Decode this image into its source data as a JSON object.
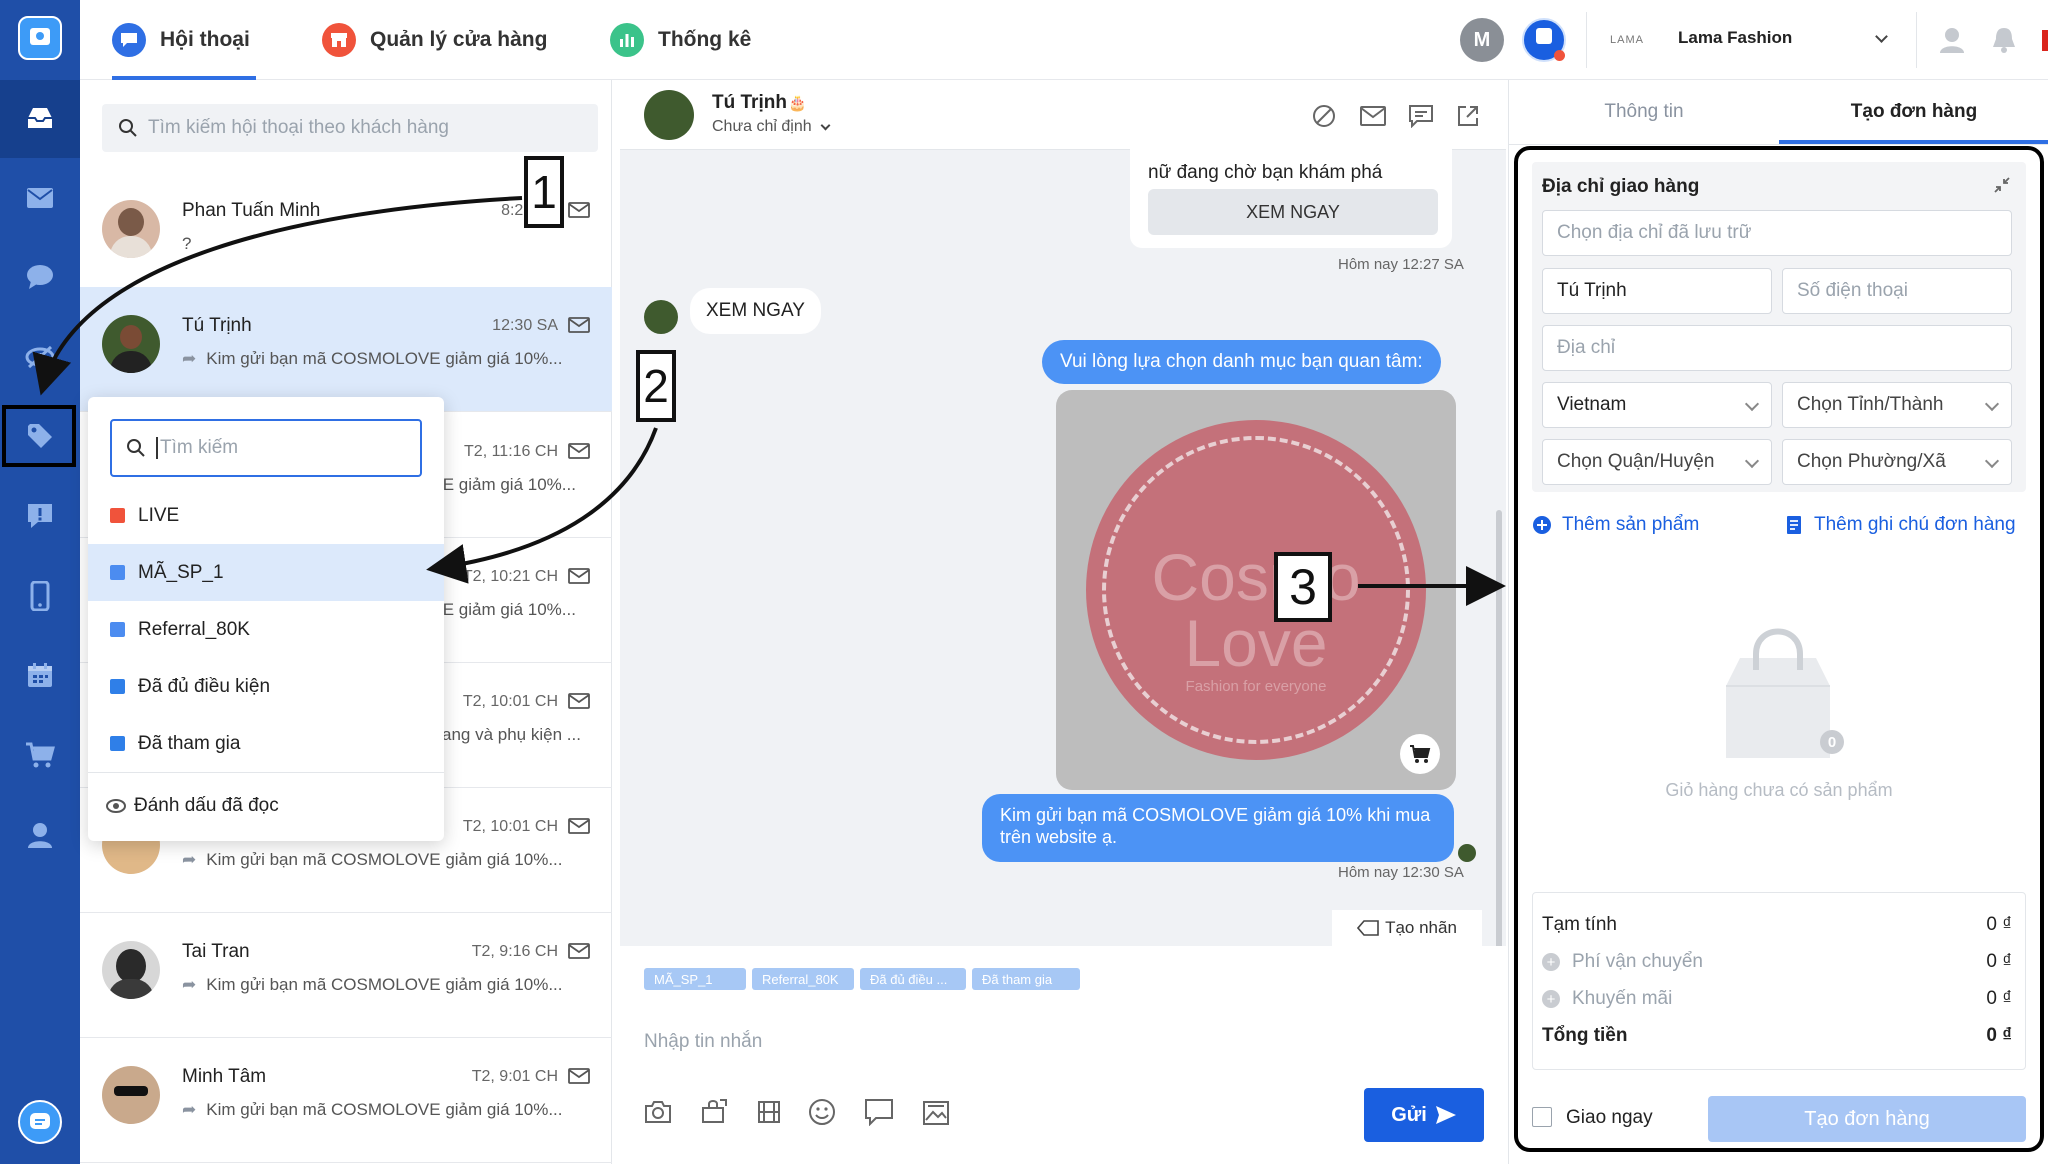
{
  "topbar": {
    "tabs": [
      {
        "label": "Hội thoại",
        "color": "#2f6fe4"
      },
      {
        "label": "Quản lý cửa hàng",
        "color": "#f0533b"
      },
      {
        "label": "Thống kê",
        "color": "#3bc38a"
      }
    ],
    "avatar_letter": "M",
    "shop_logo_text": "LAMA",
    "shop_name": "Lama Fashion"
  },
  "sidebar": {
    "icons": [
      "chat-logo-icon",
      "inbox-icon",
      "mail-icon",
      "comment-icon",
      "eye-off-icon",
      "tag-icon",
      "alert-icon",
      "phone-icon",
      "calendar-icon",
      "cart-icon",
      "user-icon",
      "messenger-icon"
    ]
  },
  "conversations": {
    "search_placeholder": "Tìm kiếm hội thoại theo khách hàng",
    "items": [
      {
        "name": "Phan Tuấn Minh",
        "time": "8:25 SA",
        "preview": "?",
        "reply": false
      },
      {
        "name": "Tú Trịnh",
        "time": "12:30 SA",
        "preview": "Kim gửi bạn mã COSMOLOVE giảm giá 10%...",
        "reply": true
      },
      {
        "name": "",
        "time": "T2, 11:16 CH",
        "preview": "/E giảm giá 10%...",
        "reply": false
      },
      {
        "name": "",
        "time": "T2, 10:21 CH",
        "preview": "/E giảm giá 10%...",
        "reply": false
      },
      {
        "name": "",
        "time": "T2, 10:01 CH",
        "preview": "ang và phụ kiện ...",
        "reply": false
      },
      {
        "name": "",
        "time": "T2, 10:01 CH",
        "preview": "Kim gửi bạn mã COSMOLOVE giảm giá 10%...",
        "reply": true
      },
      {
        "name": "Tai Tran",
        "time": "T2, 9:16 CH",
        "preview": "Kim gửi bạn mã COSMOLOVE giảm giá 10%...",
        "reply": true
      },
      {
        "name": "Minh Tâm",
        "time": "T2, 9:01 CH",
        "preview": "Kim gửi bạn mã COSMOLOVE giảm giá 10%...",
        "reply": true
      }
    ]
  },
  "tag_dropdown": {
    "search_placeholder": "Tìm kiếm",
    "tags": [
      {
        "label": "LIVE",
        "color": "#f0533b"
      },
      {
        "label": "MÃ_SP_1",
        "color": "#4c8cf0"
      },
      {
        "label": "Referral_80K",
        "color": "#4c8cf0"
      },
      {
        "label": "Đã đủ điều kiện",
        "color": "#2f7fe8"
      },
      {
        "label": "Đã tham gia",
        "color": "#2f7fe8"
      }
    ],
    "mark_read": "Đánh dấu đã đọc"
  },
  "chat": {
    "contact_name": "Tú Trịnh",
    "assign_status": "Chưa chỉ định",
    "card_text": "nữ đang chờ bạn khám phá",
    "card_button": "XEM NGAY",
    "time1": "Hôm nay 12:27 SA",
    "incoming": "XEM NGAY",
    "outgoing1": "Vui lòng lựa chọn danh mục bạn quan tâm:",
    "image_brand": "Cosmo Love",
    "image_tagline": "Fashion for everyone",
    "outgoing2": "Kim gửi bạn mã COSMOLOVE giảm giá 10% khi mua trên website ạ.",
    "time2": "Hôm nay 12:30 SA",
    "create_label": "Tạo nhãn",
    "tags": [
      "MÃ_SP_1",
      "Referral_80K",
      "Đã đủ điều ...",
      "Đã tham gia"
    ],
    "input_placeholder": "Nhập tin nhắn",
    "send": "Gửi"
  },
  "order": {
    "tabs": [
      "Thông tin",
      "Tạo đơn hàng"
    ],
    "section_title": "Địa chỉ giao hàng",
    "saved_address": "Chọn địa chỉ đã lưu trữ",
    "name_value": "Tú Trịnh",
    "phone_placeholder": "Số điện thoại",
    "address_placeholder": "Địa chỉ",
    "country": "Vietnam",
    "province": "Chọn Tỉnh/Thành",
    "district": "Chọn Quận/Huyện",
    "ward": "Chọn Phường/Xã",
    "add_product": "Thêm sản phẩm",
    "add_note": "Thêm ghi chú đơn hàng",
    "cart_count": "0",
    "cart_empty": "Giỏ hàng chưa có sản phẩm",
    "subtotal_label": "Tạm tính",
    "shipping_label": "Phí vận chuyển",
    "discount_label": "Khuyến mãi",
    "total_label": "Tổng tiền",
    "subtotal": "0 ₫",
    "shipping": "0 ₫",
    "discount": "0 ₫",
    "total": "0 ₫",
    "deliver_now": "Giao ngay",
    "create_button": "Tạo đơn hàng"
  },
  "annotations": [
    "1",
    "2",
    "3"
  ],
  "colors": {
    "sidebar": "#1f4fa8",
    "accent": "#2f6fe4",
    "send": "#1a5fe0",
    "selected": "#dce9fb"
  }
}
